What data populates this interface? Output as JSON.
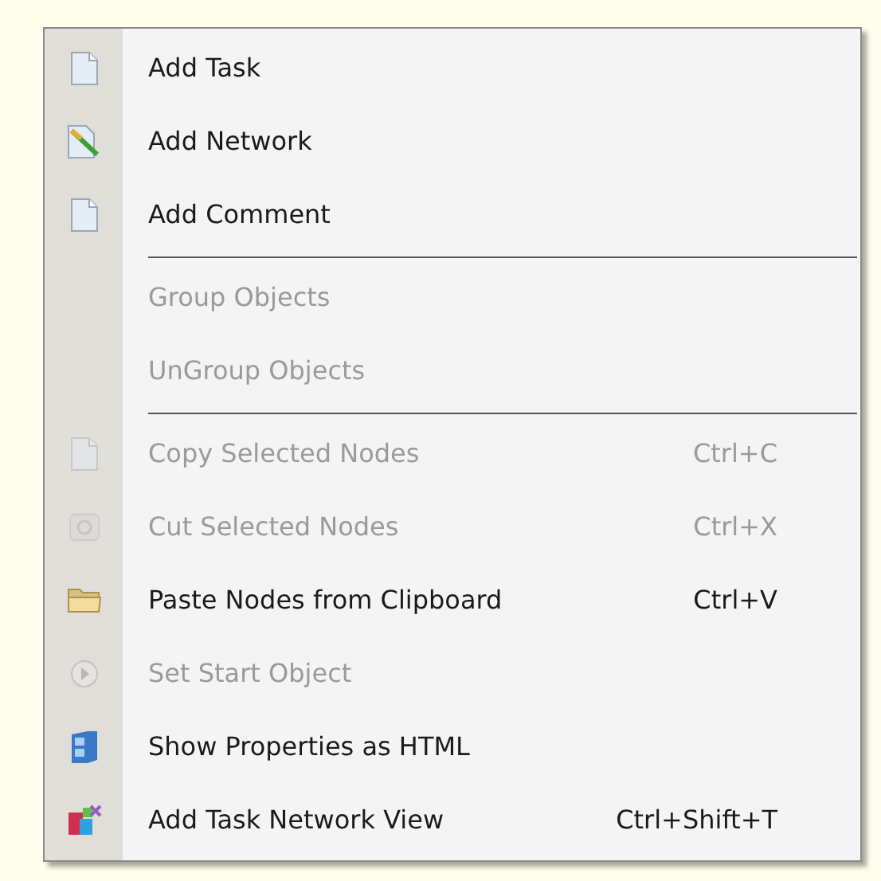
{
  "menu": {
    "items": [
      {
        "kind": "item",
        "label": "Add Task",
        "disabled": false
      },
      {
        "kind": "item",
        "label": "Add Network",
        "disabled": false
      },
      {
        "kind": "item",
        "label": "Add Comment",
        "disabled": false
      },
      {
        "kind": "separator"
      },
      {
        "kind": "item",
        "label": "Group Objects",
        "disabled": true
      },
      {
        "kind": "item",
        "label": "UnGroup Objects",
        "disabled": true
      },
      {
        "kind": "separator"
      },
      {
        "kind": "item",
        "label": "Copy Selected Nodes",
        "shortcut": "Ctrl+C",
        "disabled": true
      },
      {
        "kind": "item",
        "label": "Cut Selected Nodes",
        "shortcut": "Ctrl+X",
        "disabled": true
      },
      {
        "kind": "item",
        "label": "Paste Nodes from Clipboard",
        "shortcut": "Ctrl+V",
        "disabled": false
      },
      {
        "kind": "item",
        "label": "Set Start Object",
        "disabled": true
      },
      {
        "kind": "item",
        "label": "Show Properties as HTML",
        "disabled": false
      },
      {
        "kind": "item",
        "label": "Add Task Network View",
        "shortcut": "Ctrl+Shift+T",
        "disabled": false
      }
    ]
  }
}
